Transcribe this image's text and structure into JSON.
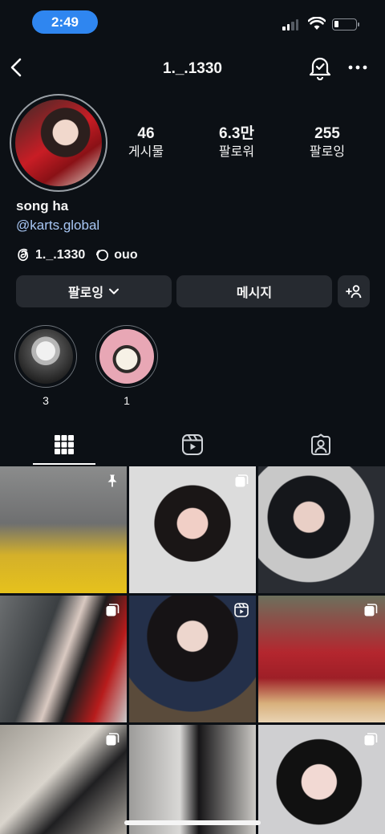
{
  "status_bar": {
    "time": "2:49",
    "icons": [
      "cellular-signal-icon",
      "wifi-icon",
      "battery-icon"
    ]
  },
  "header": {
    "username": "1._.1330",
    "icons": [
      "back-arrow-icon",
      "notification-bell-check-icon",
      "more-dots-icon"
    ]
  },
  "profile": {
    "stats": [
      {
        "value": "46",
        "label": "게시물"
      },
      {
        "value": "6.3만",
        "label": "팔로워"
      },
      {
        "value": "255",
        "label": "팔로잉"
      }
    ],
    "name": "song ha",
    "link": "@karts.global",
    "threads_handle": "1._.1330",
    "note": "ouo"
  },
  "actions": {
    "following_label": "팔로잉",
    "message_label": "메시지"
  },
  "highlights": [
    {
      "label": "3"
    },
    {
      "label": "1"
    }
  ],
  "tabs": [
    {
      "icon": "grid-icon",
      "active": true
    },
    {
      "icon": "reels-icon",
      "active": false
    },
    {
      "icon": "tagged-icon",
      "active": false
    }
  ],
  "posts": [
    {
      "badge": "pin-icon"
    },
    {
      "badge": "carousel-icon"
    },
    {
      "badge": "none"
    },
    {
      "badge": "carousel-icon"
    },
    {
      "badge": "reels-icon"
    },
    {
      "badge": "carousel-icon"
    },
    {
      "badge": "carousel-icon"
    },
    {
      "badge": "none"
    },
    {
      "badge": "carousel-icon"
    }
  ],
  "colors": {
    "background": "#0c1015",
    "button": "#262a30",
    "link": "#a8c7f5",
    "time_pill": "#2f86f0"
  }
}
